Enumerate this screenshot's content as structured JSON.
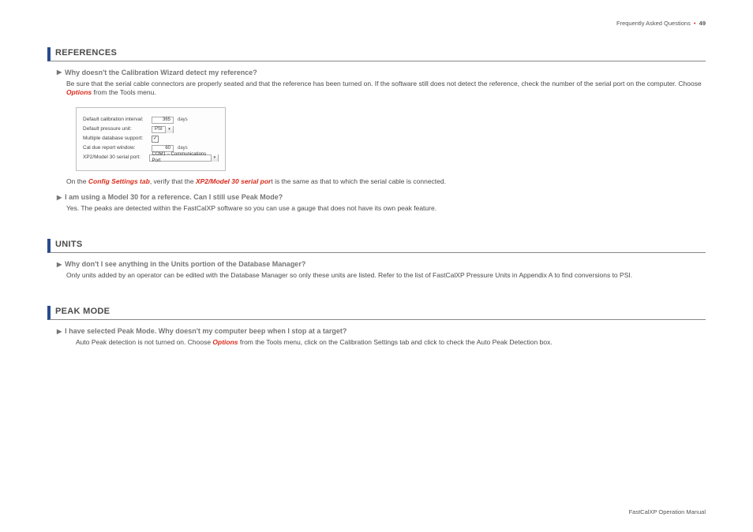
{
  "header": {
    "title": "Frequently Asked Questions",
    "page": "49"
  },
  "footer": {
    "title": "FastCalXP Operation Manual"
  },
  "sections": {
    "references": {
      "title": "REFERENCES",
      "q1": {
        "q": "Why doesn't the Calibration Wizard detect my reference?",
        "a1_pre": "Be sure that the serial cable connectors are properly seated and that the reference has been turned on. If the software still does not detect the reference, check the number of the serial port on the computer. Choose ",
        "a1_opt": "Options",
        "a1_post": " from the Tools menu.",
        "below_pre": "On the ",
        "below_link1": "Config Settings tab",
        "below_mid": ", verify that the ",
        "below_link2": "XP2/Model 30 serial por",
        "below_t": "t",
        "below_post": " is the same as that to which the serial cable is connected."
      },
      "q2": {
        "q": "I am using a Model 30 for a reference. Can I still use Peak Mode?",
        "a": "Yes. The peaks are detected within the FastCalXP software so you can use a gauge that does not have its own peak feature."
      }
    },
    "units": {
      "title": "UNITS",
      "q1": {
        "q": "Why don't I see anything in the Units portion of the Database Manager?",
        "a": "Only units added by an operator can be edited with the Database Manager so only these units are listed. Refer to the list of FastCalXP Pressure Units in Appendix A to find conversions to PSI."
      }
    },
    "peak": {
      "title": "PEAK MODE",
      "q1": {
        "q": "I have selected Peak Mode. Why doesn't my computer beep when I stop at a target?",
        "a_pre": "Auto Peak detection is not turned on. Choose ",
        "a_opt": "Options",
        "a_post": " from the Tools menu, click on the Calibration Settings tab and click to check the Auto Peak Detection box."
      }
    }
  },
  "settings": {
    "r1_label": "Default calibration interval:",
    "r1_val": "365",
    "r1_unit": "days",
    "r2_label": "Default pressure unit:",
    "r2_val": "PSI",
    "r3_label": "Multiple database support:",
    "r3_check": "✓",
    "r4_label": "Cal due report window:",
    "r4_val": "60",
    "r4_unit": "days",
    "r5_label": "XP2/Model 30 serial port:",
    "r5_val": "COM1 – Communications Port"
  }
}
